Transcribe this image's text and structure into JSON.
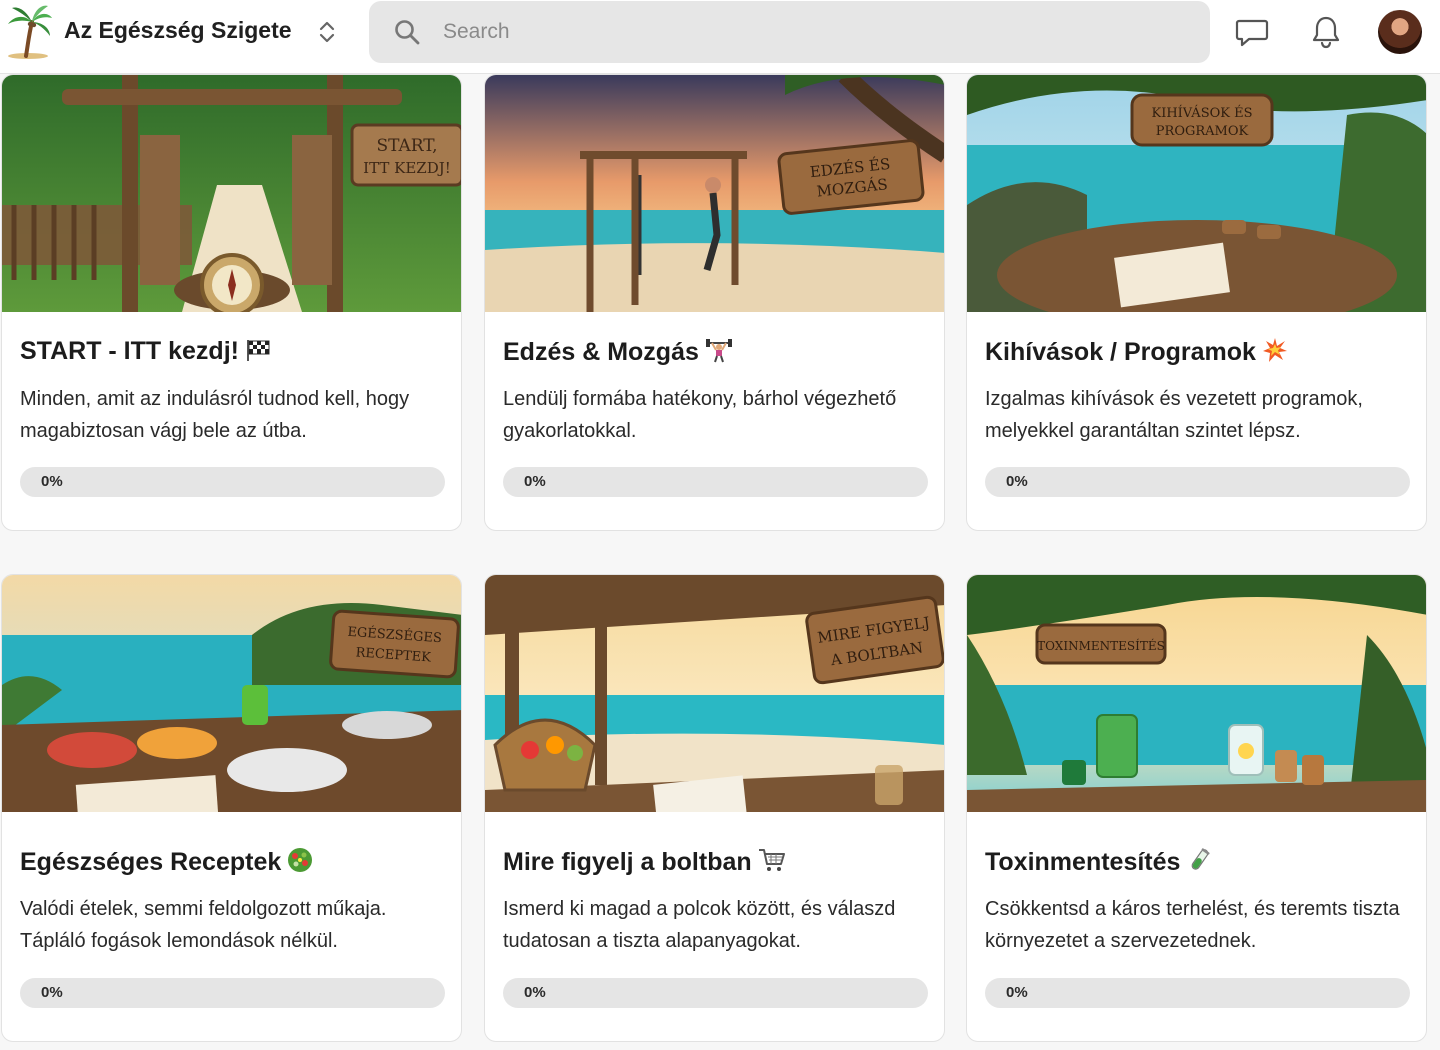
{
  "header": {
    "community_name": "Az Egészség Szigete",
    "search_placeholder": "Search",
    "icons": {
      "logo": "palm-tree-island-logo",
      "switcher": "chevron-up-down-icon",
      "search": "search-icon",
      "chat": "chat-bubble-icon",
      "notifications": "bell-icon",
      "avatar": "user-avatar"
    }
  },
  "courses": [
    {
      "title": "START - ITT kezdj!",
      "emoji": "checkered-flag",
      "description": "Minden, amit az indulásról tudnod kell, hogy magabiztosan vágj bele az útba.",
      "progress_percent": 0,
      "progress_label": "0%",
      "image_sign_text": [
        "START,",
        "ITT KEZDJ!"
      ]
    },
    {
      "title": "Edzés & Mozgás",
      "emoji": "weight-lifter",
      "description": "Lendülj formába hatékony, bárhol végezhető gyakorlatokkal.",
      "progress_percent": 0,
      "progress_label": "0%",
      "image_sign_text": [
        "EDZÉS ÉS",
        "MOZGÁS"
      ]
    },
    {
      "title": "Kihívások / Programok",
      "emoji": "collision",
      "description": "Izgalmas kihívások és vezetett programok, melyekkel garantáltan szintet lépsz.",
      "progress_percent": 0,
      "progress_label": "0%",
      "image_sign_text": [
        "KIHÍVÁSOK ÉS",
        "PROGRAMOK"
      ]
    },
    {
      "title": "Egészséges Receptek",
      "emoji": "green-salad",
      "description": "Valódi ételek, semmi feldolgozott műkaja. Tápláló fogások lemondások nélkül.",
      "progress_percent": 0,
      "progress_label": "0%",
      "image_sign_text": [
        "EGÉSZSÉGES",
        "RECEPTEK"
      ]
    },
    {
      "title": "Mire figyelj a boltban",
      "emoji": "shopping-cart",
      "description": "Ismerd ki magad a polcok között, és válaszd tudatosan a tiszta alapanyagokat.",
      "progress_percent": 0,
      "progress_label": "0%",
      "image_sign_text": [
        "MIRE FIGYELJ",
        "A BOLTBAN"
      ]
    },
    {
      "title": "Toxinmentesítés",
      "emoji": "test-tube",
      "description": "Csökkentsd a káros terhelést, és teremts tiszta környezetet a szervezetednek.",
      "progress_percent": 0,
      "progress_label": "0%",
      "image_sign_text": [
        "TOXINMENTESÍTÉS"
      ]
    }
  ],
  "colors": {
    "progress_track": "#e5e5e5",
    "progress_fill": "#5ab25e",
    "search_bg": "#e6e6e6",
    "sea": "#2bb6c4",
    "sand": "#efe2c6",
    "wood": "#8a5a36"
  }
}
